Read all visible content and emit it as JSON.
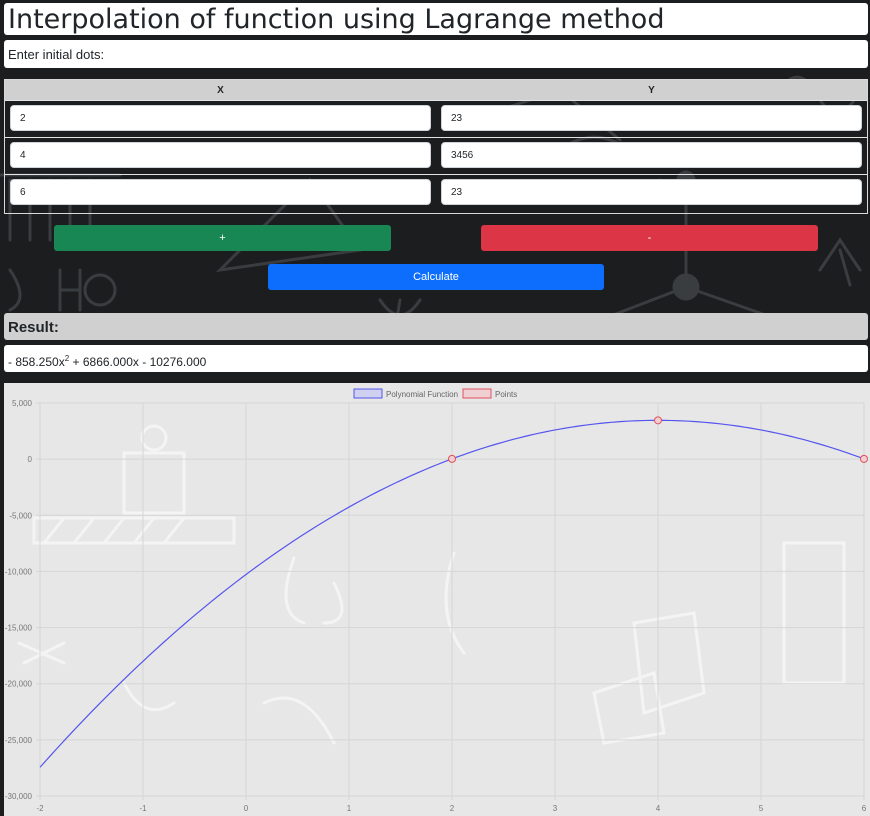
{
  "header": {
    "title": "Interpolation of function using Lagrange method"
  },
  "input": {
    "prompt": "Enter initial dots:",
    "columns": [
      "X",
      "Y"
    ],
    "rows": [
      {
        "x": "2",
        "y": "23"
      },
      {
        "x": "4",
        "y": "3456"
      },
      {
        "x": "6",
        "y": "23"
      }
    ]
  },
  "buttons": {
    "add": "+",
    "remove": "-",
    "calculate": "Calculate"
  },
  "result": {
    "heading": "Result:",
    "prefix": "- 858.250x",
    "exponent": "2",
    "suffix": " + 6866.000x - 10276.000"
  },
  "colors": {
    "add": "#198754",
    "remove": "#dc3545",
    "calculate": "#0d6efd",
    "curve": "#5555ee",
    "points": "#e05060"
  },
  "chart_data": {
    "type": "line",
    "series": [
      {
        "name": "Polynomial Function",
        "function": "-858.25x^2 + 6866x - 10276",
        "x_range": [
          -2,
          6
        ]
      },
      {
        "name": "Points",
        "x": [
          2,
          4,
          6
        ],
        "y": [
          23,
          3456,
          23
        ]
      }
    ],
    "x_ticks": [
      "-2",
      "-1",
      "0",
      "1",
      "2",
      "3",
      "4",
      "5",
      "6"
    ],
    "y_ticks": [
      "5,000",
      "0",
      "-5,000",
      "-10,000",
      "-15,000",
      "-20,000",
      "-25,000",
      "-30,000"
    ],
    "xlim": [
      -2,
      6
    ],
    "ylim": [
      -30000,
      5000
    ],
    "grid": true,
    "legend": "top-center"
  }
}
